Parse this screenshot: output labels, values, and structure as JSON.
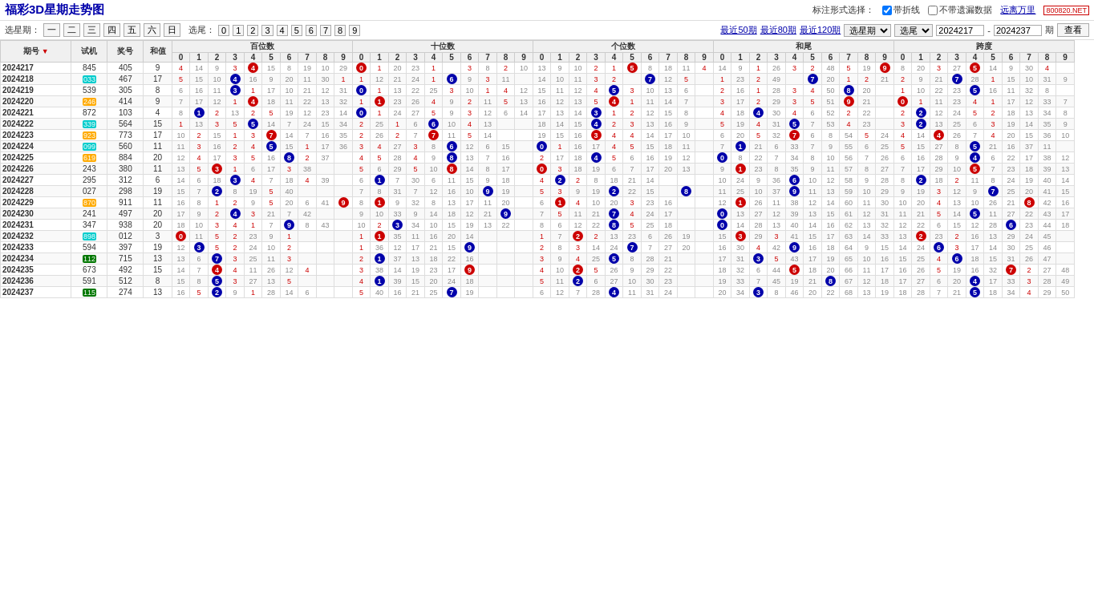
{
  "site": {
    "badge": "800820.NET",
    "title": "福彩3D星期走势图"
  },
  "controls": {
    "label_biaozhu": "标注形式选择：",
    "checkbox_daizhexian": "带折线",
    "checkbox_budaiyilou": "不带遗漏数据",
    "label_yuanmian": "远离万里",
    "label_xuanxingqi": "选星期：",
    "weekdays": [
      "一",
      "二",
      "三",
      "四",
      "五",
      "六",
      "日"
    ],
    "label_xuanwei": "选尾：",
    "tails": [
      "0",
      "1",
      "2",
      "3",
      "4",
      "5",
      "6",
      "7",
      "8",
      "9"
    ],
    "label_zuijin50": "最近50期",
    "label_zuijin80": "最近80期",
    "label_zuijin120": "最近120期",
    "label_xuanxingqi2": "选星期",
    "label_xuanwei2": "选尾",
    "period_start": "2024217",
    "period_end": "2024237",
    "label_qi": "期",
    "btn_chakan": "查看"
  },
  "table": {
    "headers": {
      "haohao": "期号",
      "shiji": "试机",
      "jianghao": "奖号",
      "hezhi": "和值",
      "sections": [
        {
          "label": "百位数",
          "digits": [
            "0",
            "1",
            "2",
            "3",
            "4",
            "5",
            "6",
            "7",
            "8",
            "9"
          ]
        },
        {
          "label": "十位数",
          "digits": [
            "0",
            "1",
            "2",
            "3",
            "4",
            "5",
            "6",
            "7",
            "8",
            "9"
          ]
        },
        {
          "label": "个位数",
          "digits": [
            "0",
            "1",
            "2",
            "3",
            "4",
            "5",
            "6",
            "7",
            "8",
            "9"
          ]
        },
        {
          "label": "和尾",
          "digits": [
            "0",
            "1",
            "2",
            "3",
            "4",
            "5",
            "6",
            "7",
            "8",
            "9"
          ]
        },
        {
          "label": "跨度",
          "digits": [
            "0",
            "1",
            "2",
            "3",
            "4",
            "5",
            "6",
            "7",
            "8",
            "9"
          ]
        }
      ]
    },
    "rows": [
      {
        "issue": "2024217",
        "shiji": "845",
        "jiang": "405",
        "he": "9",
        "bai": 4,
        "shi": 0,
        "ge": 5,
        "hetail": 9,
        "kua": 5,
        "bai_vals": "4 14 9 3 ④ 15 8 19 10 29",
        "shi_vals": "⓪ 1 20 23 1  3 8 2 10",
        "ge_vals": "13 9 10 2 1 ⑤ 8 18 11 4",
        "hetail_vals": "14 9 1 26 3 2 48 5 19 ⑨",
        "kua_vals": "8 20 3 27 ⑤ 14 9 30 4",
        "badge": ""
      },
      {
        "issue": "2024218",
        "shiji": "033",
        "jiang": "467",
        "he": "17",
        "bai": 4,
        "shi": 6,
        "ge": 7,
        "hetail": 7,
        "kua": 3,
        "badge": "cyan"
      },
      {
        "issue": "2024219",
        "shiji": "539",
        "jiang": "305",
        "he": "8",
        "bai": 3,
        "shi": 0,
        "ge": 5,
        "hetail": 8,
        "kua": 5,
        "badge": ""
      },
      {
        "issue": "2024220",
        "shiji": "246",
        "jiang": "414",
        "he": "9",
        "bai": 4,
        "shi": 1,
        "ge": 4,
        "hetail": 9,
        "kua": 0,
        "badge": "yellow"
      },
      {
        "issue": "2024221",
        "shiji": "872",
        "jiang": "103",
        "he": "4",
        "bai": 1,
        "shi": 0,
        "ge": 3,
        "hetail": 4,
        "kua": 2,
        "badge": ""
      },
      {
        "issue": "2024222",
        "shiji": "339",
        "jiang": "564",
        "he": "15",
        "bai": 5,
        "shi": 6,
        "ge": 4,
        "hetail": 5,
        "kua": 2,
        "badge": "cyan"
      },
      {
        "issue": "2024223",
        "shiji": "923",
        "jiang": "773",
        "he": "17",
        "bai": 7,
        "shi": 7,
        "ge": 3,
        "hetail": 7,
        "kua": 4,
        "badge": "yellow"
      },
      {
        "issue": "2024224",
        "shiji": "099",
        "jiang": "560",
        "he": "11",
        "bai": 5,
        "shi": 6,
        "ge": 0,
        "hetail": 1,
        "kua": 5,
        "badge": "cyan"
      },
      {
        "issue": "2024225",
        "shiji": "619",
        "jiang": "884",
        "he": "20",
        "bai": 8,
        "shi": 8,
        "ge": 4,
        "hetail": 0,
        "kua": 4,
        "badge": "yellow"
      },
      {
        "issue": "2024226",
        "shiji": "243",
        "jiang": "380",
        "he": "11",
        "bai": 3,
        "shi": 8,
        "ge": 0,
        "hetail": 1,
        "kua": 5,
        "badge": ""
      },
      {
        "issue": "2024227",
        "shiji": "295",
        "jiang": "312",
        "he": "6",
        "bai": 3,
        "shi": 1,
        "ge": 2,
        "hetail": 6,
        "kua": 2,
        "badge": ""
      },
      {
        "issue": "2024228",
        "shiji": "027",
        "jiang": "298",
        "he": "19",
        "bai": 2,
        "shi": 9,
        "ge": 8,
        "hetail": 9,
        "kua": 7,
        "badge": ""
      },
      {
        "issue": "2024229",
        "shiji": "870",
        "jiang": "911",
        "he": "11",
        "bai": 9,
        "shi": 1,
        "ge": 1,
        "hetail": 1,
        "kua": 8,
        "badge": "yellow"
      },
      {
        "issue": "2024230",
        "shiji": "241",
        "jiang": "497",
        "he": "20",
        "bai": 4,
        "shi": 9,
        "ge": 7,
        "hetail": 0,
        "kua": 5,
        "badge": ""
      },
      {
        "issue": "2024231",
        "shiji": "347",
        "jiang": "938",
        "he": "20",
        "bai": 9,
        "shi": 3,
        "ge": 8,
        "hetail": 0,
        "kua": 6,
        "badge": ""
      },
      {
        "issue": "2024232",
        "shiji": "898",
        "jiang": "012",
        "he": "3",
        "bai": 0,
        "shi": 1,
        "ge": 2,
        "hetail": 3,
        "kua": 2,
        "badge": "cyan"
      },
      {
        "issue": "2024233",
        "shiji": "594",
        "jiang": "397",
        "he": "19",
        "bai": 3,
        "shi": 9,
        "ge": 7,
        "hetail": 9,
        "kua": 6,
        "badge": ""
      },
      {
        "issue": "2024234",
        "shiji": "112",
        "jiang": "715",
        "he": "13",
        "bai": 7,
        "shi": 1,
        "ge": 5,
        "hetail": 3,
        "kua": 6,
        "badge": "green"
      },
      {
        "issue": "2024235",
        "shiji": "673",
        "jiang": "492",
        "he": "15",
        "bai": 4,
        "shi": 9,
        "ge": 2,
        "hetail": 5,
        "kua": 7,
        "badge": ""
      },
      {
        "issue": "2024236",
        "shiji": "591",
        "jiang": "512",
        "he": "8",
        "bai": 5,
        "shi": 1,
        "ge": 2,
        "hetail": 8,
        "kua": 4,
        "badge": ""
      },
      {
        "issue": "2024237",
        "shiji": "115",
        "jiang": "274",
        "he": "13",
        "bai": 2,
        "shi": 7,
        "ge": 4,
        "hetail": 3,
        "kua": 5,
        "badge": "green"
      }
    ]
  }
}
